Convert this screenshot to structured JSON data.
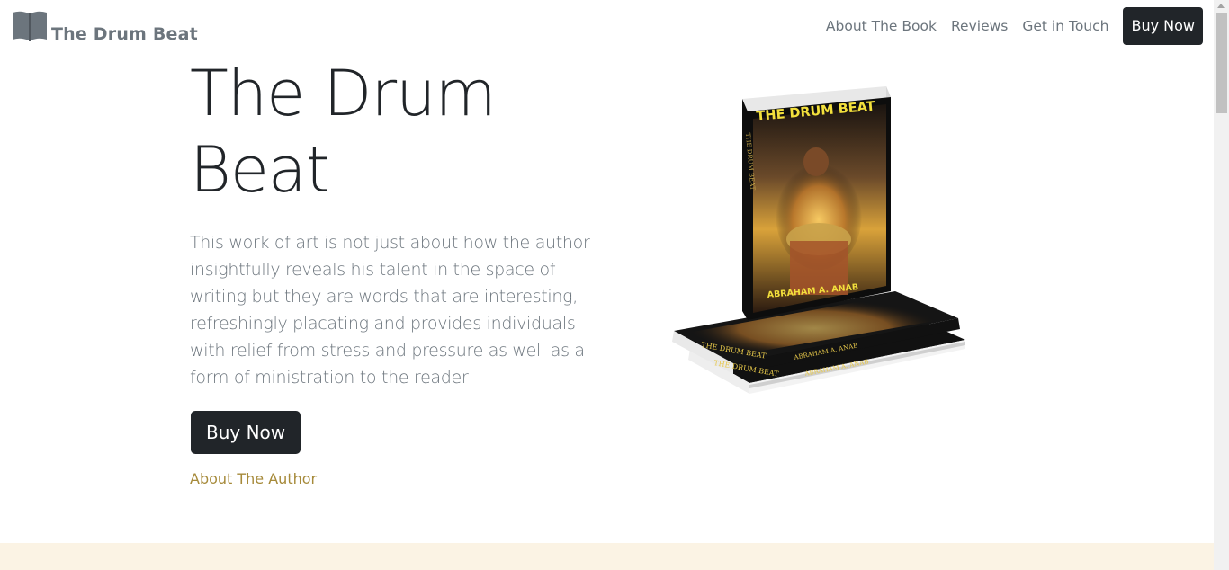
{
  "brand": {
    "name": "The Drum Beat",
    "icon": "open-book-icon"
  },
  "nav": {
    "links": [
      "About The Book",
      "Reviews",
      "Get in Touch"
    ],
    "cta": "Buy Now"
  },
  "hero": {
    "title": "The Drum Beat",
    "description": "This work of art is not just about how the author insightfully reveals his talent in the space of writing but they are words that are interesting, refreshingly placating and provides individuals with relief from stress and pressure as well as a form of ministration to the reader",
    "button": "Buy Now",
    "author_link": "About The Author"
  },
  "book": {
    "cover_title": "THE DRUM BEAT",
    "author": "ABRAHAM A. ANAB",
    "spine_title": "THE DRUM BEAT"
  },
  "colors": {
    "dark": "#212529",
    "muted": "#6c757d",
    "link": "#a68a3a",
    "band": "#fbf3e4"
  }
}
